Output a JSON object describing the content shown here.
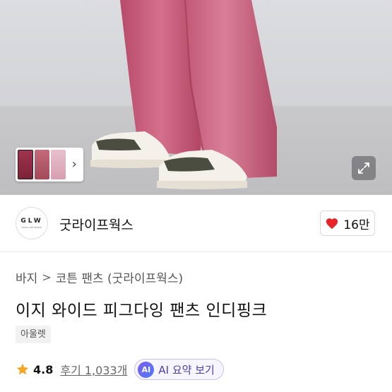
{
  "product_image": {
    "thumbnails": [
      "thumbnail-1",
      "thumbnail-2",
      "thumbnail-3"
    ],
    "icons": {
      "thumbs_next": "chevron-right-icon",
      "expand": "expand-icon"
    }
  },
  "seller": {
    "logo_text": "GLW",
    "logo_subtext": "GOOD LIFE WORKS",
    "name": "굿라이프웍스"
  },
  "like": {
    "count": "16만",
    "icon": "heart-icon",
    "color": "#e8242b"
  },
  "breadcrumb": {
    "category": "바지",
    "separator": ">",
    "subcategory": "코튼 팬츠 (굿라이프웍스)"
  },
  "product": {
    "title": "이지 와이드 피그다잉 팬츠 인디핑크",
    "tag": "아울렛"
  },
  "rating": {
    "score": "4.8",
    "star_color": "#f5a623",
    "review_label": "후기 1,033개"
  },
  "ai_summary": {
    "badge": "AI",
    "label": "AI 요약 보기"
  }
}
